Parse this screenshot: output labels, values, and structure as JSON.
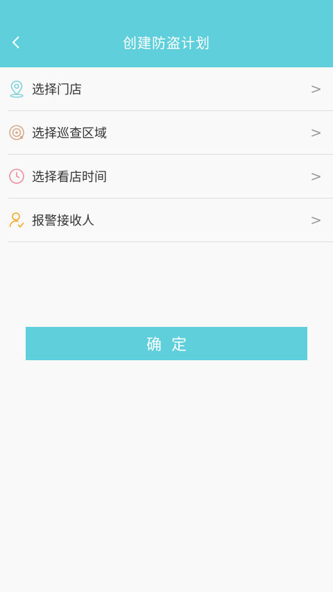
{
  "header": {
    "title": "创建防盗计划",
    "back_icon": "chevron-left-icon"
  },
  "menu": {
    "items": [
      {
        "label": "选择门店",
        "icon": "location-pin-icon",
        "icon_color": "#7fd0d9"
      },
      {
        "label": "选择巡查区域",
        "icon": "patrol-area-icon",
        "icon_color": "#d7a98a"
      },
      {
        "label": "选择看店时间",
        "icon": "clock-icon",
        "icon_color": "#f08aa0"
      },
      {
        "label": "报警接收人",
        "icon": "user-check-icon",
        "icon_color": "#f5a623"
      }
    ],
    "chevron": ">"
  },
  "confirm": {
    "label": "确定"
  },
  "colors": {
    "accent": "#5fcfdb",
    "background": "#f9f9f9",
    "divider": "#dcdcdc",
    "text": "#333333"
  }
}
